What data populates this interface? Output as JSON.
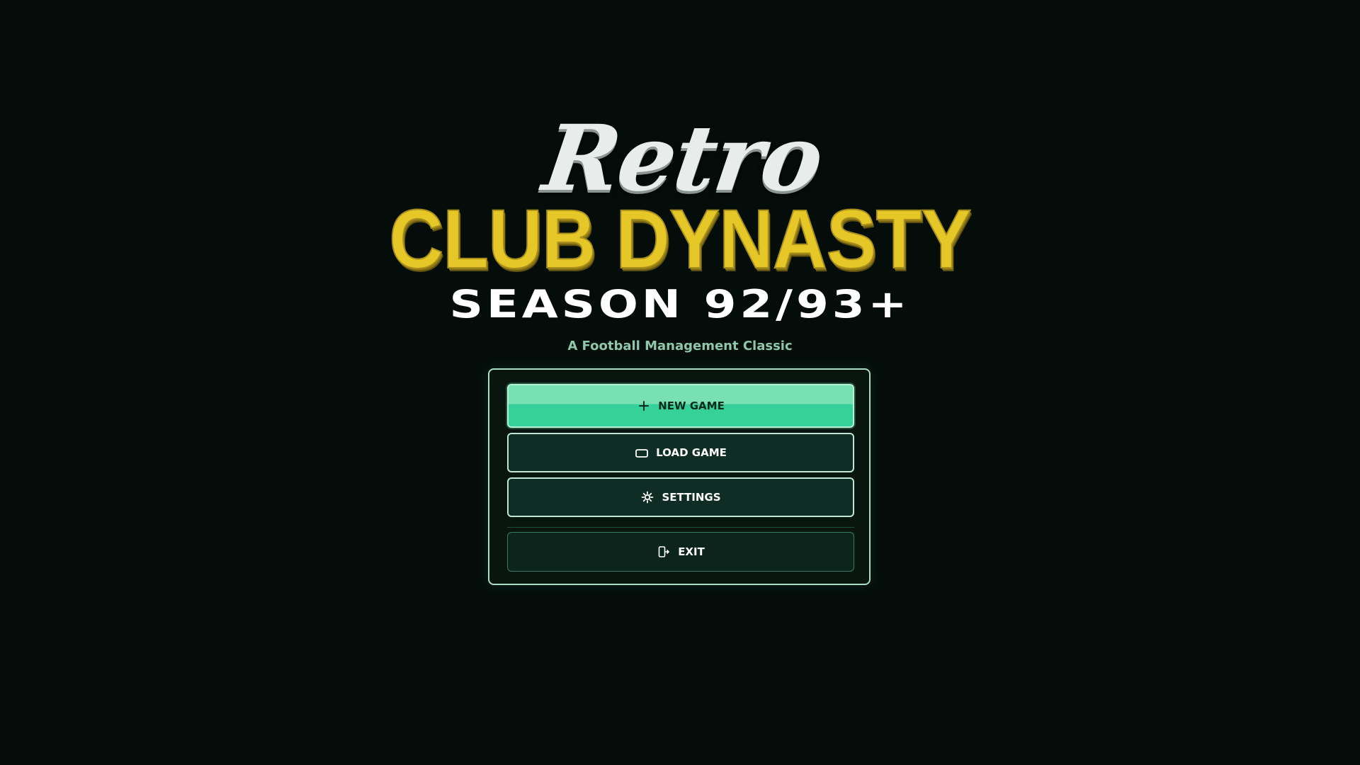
{
  "title": {
    "retro": "Retro",
    "main": "CLUB DYNASTY",
    "season": "SEASON 92/93+",
    "tagline": "A Football Management Classic"
  },
  "menu": {
    "new_game": {
      "label": "NEW GAME",
      "icon": "plus-icon"
    },
    "load_game": {
      "label": "LOAD GAME",
      "icon": "folder-icon"
    },
    "settings": {
      "label": "SETTINGS",
      "icon": "gear-icon"
    },
    "exit": {
      "label": "EXIT",
      "icon": "exit-door-icon"
    }
  },
  "colors": {
    "background": "#050d0b",
    "accent": "#36d19a",
    "title_gold": "#e6c728",
    "tagline": "#8fc7ac",
    "panel_border": "#a9dcc4"
  }
}
